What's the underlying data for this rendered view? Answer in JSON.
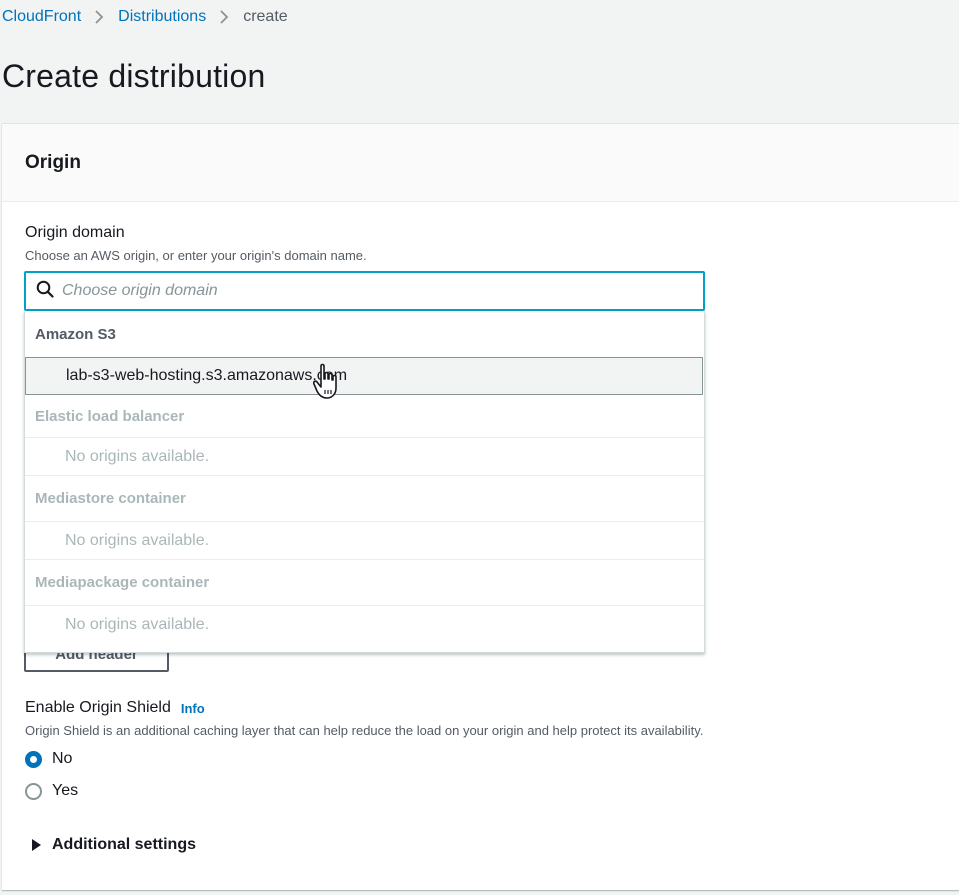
{
  "breadcrumb": {
    "items": [
      "CloudFront",
      "Distributions"
    ],
    "current": "create"
  },
  "page": {
    "title": "Create distribution"
  },
  "origin_panel": {
    "title": "Origin",
    "origin_domain": {
      "label": "Origin domain",
      "description": "Choose an AWS origin, or enter your origin's domain name.",
      "placeholder": "Choose origin domain"
    },
    "dropdown": {
      "groups": [
        {
          "name": "Amazon S3",
          "option": "lab-s3-web-hosting.s3.amazonaws.com"
        },
        {
          "name": "Elastic load balancer",
          "option": "No origins available."
        },
        {
          "name": "Mediastore container",
          "option": "No origins available."
        },
        {
          "name": "Mediapackage container",
          "option": "No origins available."
        }
      ]
    },
    "add_header_label": "Add header",
    "origin_shield": {
      "label": "Enable Origin Shield",
      "info": "Info",
      "description": "Origin Shield is an additional caching layer that can help reduce the load on your origin and help protect its availability.",
      "options": [
        "No",
        "Yes"
      ],
      "selected": "No"
    },
    "additional_settings": "Additional settings"
  },
  "colors": {
    "link": "#0073bb",
    "focus_border": "#00a1c9",
    "disabled_text": "#aab7b8"
  }
}
